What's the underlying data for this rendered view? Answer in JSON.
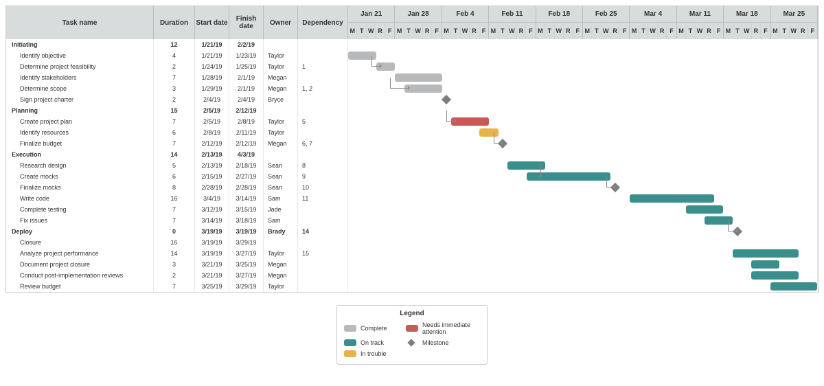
{
  "headers": {
    "task": "Task name",
    "duration": "Duration",
    "start": "Start date",
    "finish": "Finish date",
    "owner": "Owner",
    "dependency": "Dependency"
  },
  "weeks": [
    "Jan 21",
    "Jan 28",
    "Feb 4",
    "Feb 11",
    "Feb 18",
    "Feb 25",
    "Mar 4",
    "Mar 11",
    "Mar 18",
    "Mar 25"
  ],
  "day_labels": [
    "M",
    "T",
    "W",
    "R",
    "F"
  ],
  "legend": {
    "title": "Legend",
    "items": [
      {
        "label": "Complete",
        "color": "complete"
      },
      {
        "label": "On track",
        "color": "ontrack"
      },
      {
        "label": "In trouble",
        "color": "trouble"
      },
      {
        "label": "Needs immediate attention",
        "color": "attention"
      },
      {
        "label": "Milestone",
        "color": "milestone"
      }
    ]
  },
  "rows": [
    {
      "type": "phase",
      "name": "Initiating",
      "duration": "12",
      "start": "1/21/19",
      "finish": "2/2/19",
      "owner": "",
      "dep": ""
    },
    {
      "type": "task",
      "name": "Identify objective",
      "duration": "4",
      "start": "1/21/19",
      "finish": "1/23/19",
      "owner": "Taylor",
      "dep": "",
      "bar": {
        "col": 1,
        "span": 3,
        "color": "complete"
      }
    },
    {
      "type": "task",
      "name": "Determine project feasibility",
      "duration": "2",
      "start": "1/24/19",
      "finish": "1/25/19",
      "owner": "Taylor",
      "dep": "1",
      "bar": {
        "col": 4,
        "span": 2,
        "color": "complete"
      },
      "arrow_from": 3
    },
    {
      "type": "task",
      "name": "Identify stakeholders",
      "duration": "7",
      "start": "1/28/19",
      "finish": "2/1/19",
      "owner": "Megan",
      "dep": "",
      "bar": {
        "col": 6,
        "span": 5,
        "color": "complete"
      }
    },
    {
      "type": "task",
      "name": "Determine scope",
      "duration": "3",
      "start": "1/29/19",
      "finish": "2/1/19",
      "owner": "Megan",
      "dep": "1, 2",
      "bar": {
        "col": 7,
        "span": 4,
        "color": "complete"
      },
      "arrow_from": 5
    },
    {
      "type": "task",
      "name": "Sign project charter",
      "duration": "2",
      "start": "2/4/19",
      "finish": "2/4/19",
      "owner": "Bryce",
      "dep": "",
      "milestone": {
        "col": 11
      }
    },
    {
      "type": "phase",
      "name": "Planning",
      "duration": "15",
      "start": "2/5/19",
      "finish": "2/12/19",
      "owner": "",
      "dep": ""
    },
    {
      "type": "task",
      "name": "Create project plan",
      "duration": "7",
      "start": "2/5/19",
      "finish": "2/8/19",
      "owner": "Taylor",
      "dep": "5",
      "bar": {
        "col": 12,
        "span": 4,
        "color": "attention"
      },
      "arrow_from": 11
    },
    {
      "type": "task",
      "name": "Identify resources",
      "duration": "6",
      "start": "2/8/19",
      "finish": "2/11/19",
      "owner": "Taylor",
      "dep": "",
      "bar": {
        "col": 15,
        "span": 2,
        "color": "trouble"
      }
    },
    {
      "type": "task",
      "name": "Finalize budget",
      "duration": "7",
      "start": "2/12/19",
      "finish": "2/12/19",
      "owner": "Megan",
      "dep": "6, 7",
      "milestone": {
        "col": 17
      },
      "arrow_from": 16
    },
    {
      "type": "phase",
      "name": "Execution",
      "duration": "14",
      "start": "2/13/19",
      "finish": "4/3/19",
      "owner": "",
      "dep": ""
    },
    {
      "type": "task",
      "name": "Research design",
      "duration": "5",
      "start": "2/13/19",
      "finish": "2/18/19",
      "owner": "Sean",
      "dep": "8",
      "bar": {
        "col": 18,
        "span": 4,
        "color": "ontrack"
      }
    },
    {
      "type": "task",
      "name": "Create mocks",
      "duration": "6",
      "start": "2/15/19",
      "finish": "2/27/19",
      "owner": "Sean",
      "dep": "9",
      "bar": {
        "col": 20,
        "span": 9,
        "color": "ontrack"
      },
      "arrow_from": 21
    },
    {
      "type": "task",
      "name": "Finalize mocks",
      "duration": "8",
      "start": "2/28/19",
      "finish": "2/28/19",
      "owner": "Sean",
      "dep": "10",
      "milestone": {
        "col": 29
      },
      "arrow_from": 28
    },
    {
      "type": "task",
      "name": "Write code",
      "duration": "16",
      "start": "3/4/19",
      "finish": "3/14/19",
      "owner": "Sam",
      "dep": "11",
      "bar": {
        "col": 31,
        "span": 9,
        "color": "ontrack"
      }
    },
    {
      "type": "task",
      "name": "Complete testing",
      "duration": "7",
      "start": "3/12/19",
      "finish": "3/15/19",
      "owner": "Jade",
      "dep": "",
      "bar": {
        "col": 37,
        "span": 4,
        "color": "ontrack"
      }
    },
    {
      "type": "task",
      "name": "Fix issues",
      "duration": "7",
      "start": "3/14/19",
      "finish": "3/18/19",
      "owner": "Sam",
      "dep": "",
      "bar": {
        "col": 39,
        "span": 3,
        "color": "ontrack"
      }
    },
    {
      "type": "phase",
      "name": "Deploy",
      "duration": "0",
      "start": "3/19/19",
      "finish": "3/19/19",
      "owner": "Brady",
      "dep": "14",
      "milestone": {
        "col": 42
      },
      "arrow_from": 41
    },
    {
      "type": "task",
      "name": "Closure",
      "duration": "16",
      "start": "3/19/19",
      "finish": "3/29/19",
      "owner": "",
      "dep": ""
    },
    {
      "type": "task",
      "name": "Analyze project performance",
      "duration": "14",
      "start": "3/19/19",
      "finish": "3/27/19",
      "owner": "Taylor",
      "dep": "15",
      "bar": {
        "col": 42,
        "span": 7,
        "color": "ontrack"
      }
    },
    {
      "type": "task",
      "name": "Document project closure",
      "duration": "3",
      "start": "3/21/19",
      "finish": "3/25/19",
      "owner": "Megan",
      "dep": "",
      "bar": {
        "col": 44,
        "span": 3,
        "color": "ontrack"
      }
    },
    {
      "type": "task",
      "name": "Conduct post-implementation reviews",
      "duration": "2",
      "start": "3/21/19",
      "finish": "3/27/19",
      "owner": "Megan",
      "dep": "",
      "bar": {
        "col": 44,
        "span": 5,
        "color": "ontrack"
      }
    },
    {
      "type": "task",
      "name": "Review budget",
      "duration": "7",
      "start": "3/25/19",
      "finish": "3/29/19",
      "owner": "Taylor",
      "dep": "",
      "bar": {
        "col": 46,
        "span": 5,
        "color": "ontrack"
      }
    }
  ],
  "chart_data": {
    "type": "gantt",
    "title": "",
    "x_axis": {
      "label": "",
      "weeks": [
        "Jan 21",
        "Jan 28",
        "Feb 4",
        "Feb 11",
        "Feb 18",
        "Feb 25",
        "Mar 4",
        "Mar 11",
        "Mar 18",
        "Mar 25"
      ],
      "weekdays": [
        "M",
        "T",
        "W",
        "R",
        "F"
      ]
    },
    "status_colors": {
      "complete": "#b7b9ba",
      "on_track": "#3a8e8c",
      "in_trouble": "#e8b24a",
      "needs_immediate_attention": "#c65a54",
      "milestone": "#7a7f80"
    },
    "phases": [
      {
        "name": "Initiating",
        "duration_days": 12,
        "start": "1/21/19",
        "finish": "2/2/19",
        "tasks": [
          {
            "id": 1,
            "name": "Identify objective",
            "duration_days": 4,
            "start": "1/21/19",
            "finish": "1/23/19",
            "owner": "Taylor",
            "status": "complete",
            "depends_on": []
          },
          {
            "id": 2,
            "name": "Determine project feasibility",
            "duration_days": 2,
            "start": "1/24/19",
            "finish": "1/25/19",
            "owner": "Taylor",
            "status": "complete",
            "depends_on": [
              1
            ]
          },
          {
            "id": 3,
            "name": "Identify stakeholders",
            "duration_days": 7,
            "start": "1/28/19",
            "finish": "2/1/19",
            "owner": "Megan",
            "status": "complete",
            "depends_on": []
          },
          {
            "id": 4,
            "name": "Determine scope",
            "duration_days": 3,
            "start": "1/29/19",
            "finish": "2/1/19",
            "owner": "Megan",
            "status": "complete",
            "depends_on": [
              1,
              2
            ]
          },
          {
            "id": 5,
            "name": "Sign project charter",
            "duration_days": 2,
            "start": "2/4/19",
            "finish": "2/4/19",
            "owner": "Bryce",
            "status": "milestone",
            "depends_on": []
          }
        ]
      },
      {
        "name": "Planning",
        "duration_days": 15,
        "start": "2/5/19",
        "finish": "2/12/19",
        "tasks": [
          {
            "id": 6,
            "name": "Create project plan",
            "duration_days": 7,
            "start": "2/5/19",
            "finish": "2/8/19",
            "owner": "Taylor",
            "status": "needs_immediate_attention",
            "depends_on": [
              5
            ]
          },
          {
            "id": 7,
            "name": "Identify resources",
            "duration_days": 6,
            "start": "2/8/19",
            "finish": "2/11/19",
            "owner": "Taylor",
            "status": "in_trouble",
            "depends_on": []
          },
          {
            "id": 8,
            "name": "Finalize budget",
            "duration_days": 7,
            "start": "2/12/19",
            "finish": "2/12/19",
            "owner": "Megan",
            "status": "milestone",
            "depends_on": [
              6,
              7
            ]
          }
        ]
      },
      {
        "name": "Execution",
        "duration_days": 14,
        "start": "2/13/19",
        "finish": "4/3/19",
        "tasks": [
          {
            "id": 9,
            "name": "Research design",
            "duration_days": 5,
            "start": "2/13/19",
            "finish": "2/18/19",
            "owner": "Sean",
            "status": "on_track",
            "depends_on": [
              8
            ]
          },
          {
            "id": 10,
            "name": "Create mocks",
            "duration_days": 6,
            "start": "2/15/19",
            "finish": "2/27/19",
            "owner": "Sean",
            "status": "on_track",
            "depends_on": [
              9
            ]
          },
          {
            "id": 11,
            "name": "Finalize mocks",
            "duration_days": 8,
            "start": "2/28/19",
            "finish": "2/28/19",
            "owner": "Sean",
            "status": "milestone",
            "depends_on": [
              10
            ]
          },
          {
            "id": 12,
            "name": "Write code",
            "duration_days": 16,
            "start": "3/4/19",
            "finish": "3/14/19",
            "owner": "Sam",
            "status": "on_track",
            "depends_on": [
              11
            ]
          },
          {
            "id": 13,
            "name": "Complete testing",
            "duration_days": 7,
            "start": "3/12/19",
            "finish": "3/15/19",
            "owner": "Jade",
            "status": "on_track",
            "depends_on": []
          },
          {
            "id": 14,
            "name": "Fix issues",
            "duration_days": 7,
            "start": "3/14/19",
            "finish": "3/18/19",
            "owner": "Sam",
            "status": "on_track",
            "depends_on": []
          }
        ]
      },
      {
        "name": "Deploy",
        "duration_days": 0,
        "start": "3/19/19",
        "finish": "3/19/19",
        "owner": "Brady",
        "status": "milestone",
        "depends_on": [
          14
        ],
        "tasks": [
          {
            "id": 15,
            "name": "Closure",
            "duration_days": 16,
            "start": "3/19/19",
            "finish": "3/29/19",
            "owner": "",
            "status": "",
            "depends_on": []
          },
          {
            "id": 16,
            "name": "Analyze project performance",
            "duration_days": 14,
            "start": "3/19/19",
            "finish": "3/27/19",
            "owner": "Taylor",
            "status": "on_track",
            "depends_on": [
              15
            ]
          },
          {
            "id": 17,
            "name": "Document project closure",
            "duration_days": 3,
            "start": "3/21/19",
            "finish": "3/25/19",
            "owner": "Megan",
            "status": "on_track",
            "depends_on": []
          },
          {
            "id": 18,
            "name": "Conduct post-implementation reviews",
            "duration_days": 2,
            "start": "3/21/19",
            "finish": "3/27/19",
            "owner": "Megan",
            "status": "on_track",
            "depends_on": []
          },
          {
            "id": 19,
            "name": "Review budget",
            "duration_days": 7,
            "start": "3/25/19",
            "finish": "3/29/19",
            "owner": "Taylor",
            "status": "on_track",
            "depends_on": []
          }
        ]
      }
    ]
  }
}
